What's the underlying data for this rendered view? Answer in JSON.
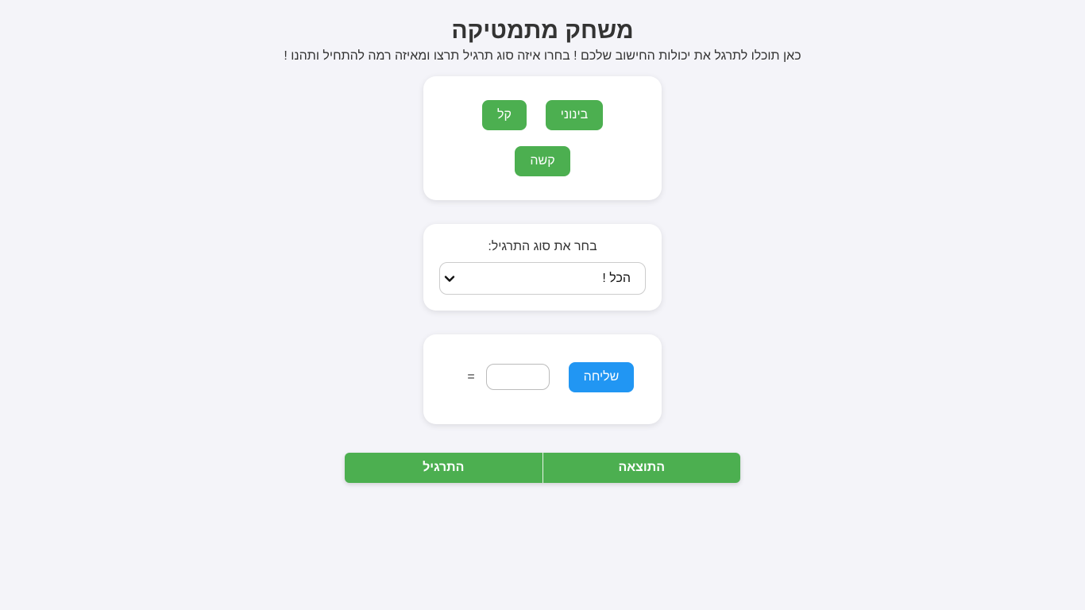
{
  "header": {
    "title": "משחק מתמטיקה",
    "subtitle": "כאן תוכלו לתרגל את יכולות החישוב שלכם ! בחרו איזה סוג תרגיל תרצו ומאיזה רמה להתחיל ותהנו !"
  },
  "levels": {
    "medium_label": "בינוני",
    "easy_label": "קל",
    "hard_label": "קשה"
  },
  "exercise_type": {
    "label": "בחר את סוג התרגיל:",
    "selected": "הכל !",
    "icon": "chevron-down-icon"
  },
  "answer": {
    "send_label": "שליחה",
    "input_value": "",
    "equals_sign": "="
  },
  "results_table": {
    "columns": [
      "התוצאה",
      "התרגיל"
    ]
  },
  "colors": {
    "background": "#f4f4f9",
    "green": "#4caf50",
    "blue": "#2196f3",
    "text": "#333333"
  }
}
